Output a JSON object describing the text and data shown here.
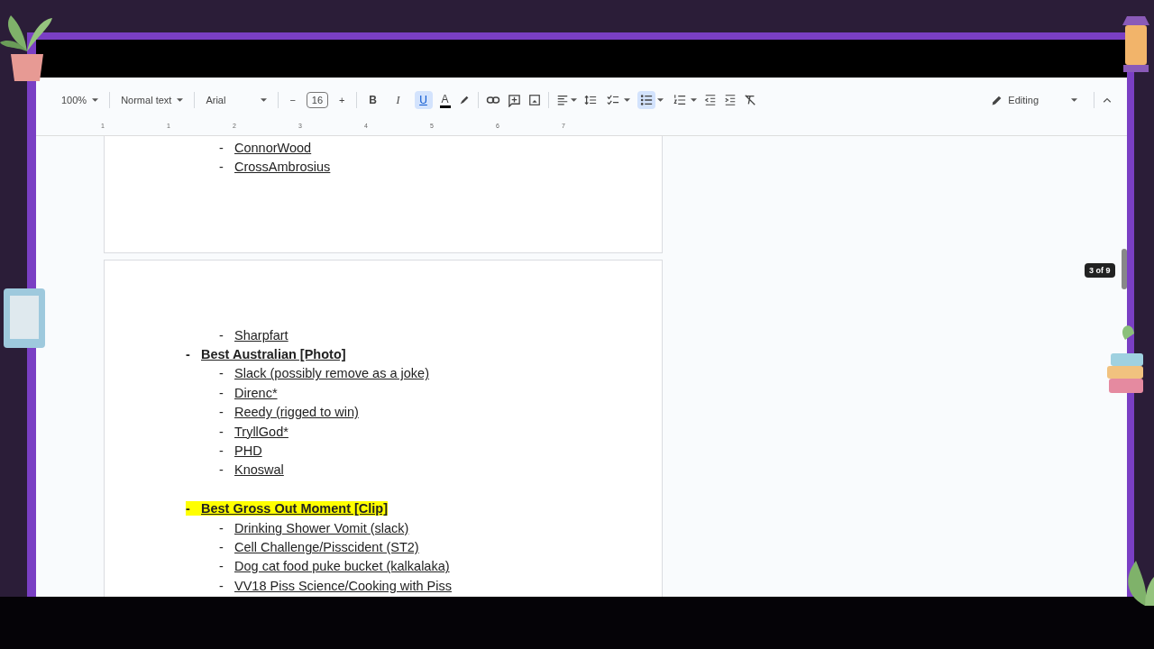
{
  "toolbar": {
    "zoom": "100%",
    "style": "Normal text",
    "font": "Arial",
    "font_size": "16",
    "minus": "−",
    "plus": "+",
    "format_buttons": [
      {
        "label": "B",
        "selected": false
      },
      {
        "label": "I",
        "selected": false
      },
      {
        "label": "U",
        "selected": true
      }
    ],
    "text_color": "A",
    "list_buttons": [
      {
        "kind": "checklist",
        "selected": false
      },
      {
        "kind": "bullet",
        "selected": true
      },
      {
        "kind": "numbered",
        "selected": false
      }
    ],
    "mode": "Editing"
  },
  "ruler": {
    "labels": [
      "1",
      "1",
      "2",
      "3",
      "4",
      "5",
      "6",
      "7"
    ]
  },
  "pages": [
    {
      "items": [
        {
          "kind": "entry",
          "children": [
            {
              "bullet": "-",
              "text": "ConnorWood"
            },
            {
              "bullet": "-",
              "text": "CrossAmbrosius"
            }
          ]
        }
      ]
    },
    {
      "items": [
        {
          "kind": "entry",
          "children": [
            {
              "bullet": "-",
              "text": "Sharpfart"
            }
          ]
        },
        {
          "kind": "entry",
          "bullet": "-",
          "text": "Best Australian [Photo]",
          "highlighted": false,
          "children": [
            {
              "bullet": "-",
              "text": "Slack (possibly remove as a joke)"
            },
            {
              "bullet": "-",
              "text": "Direnc*"
            },
            {
              "bullet": "-",
              "text": "Reedy (rigged to win)"
            },
            {
              "bullet": "-",
              "text": "TryllGod*"
            },
            {
              "bullet": "-",
              "text": "PHD"
            },
            {
              "bullet": "-",
              "text": "Knoswal"
            }
          ]
        },
        {
          "kind": "blank"
        },
        {
          "kind": "entry",
          "bullet": "-",
          "text": "Best Gross Out Moment [Clip]",
          "highlighted": true,
          "children": [
            {
              "bullet": "-",
              "text": "Drinking Shower Vomit (slack)"
            },
            {
              "bullet": "-",
              "text": "Cell Challenge/Pisscident (ST2)"
            },
            {
              "bullet": "-",
              "text": "Dog cat food puke bucket (kalkalaka)"
            },
            {
              "bullet": "-",
              "text": "VV18 Piss Science/Cooking with Piss"
            }
          ]
        }
      ]
    }
  ],
  "page_indicator": "3 of 9"
}
